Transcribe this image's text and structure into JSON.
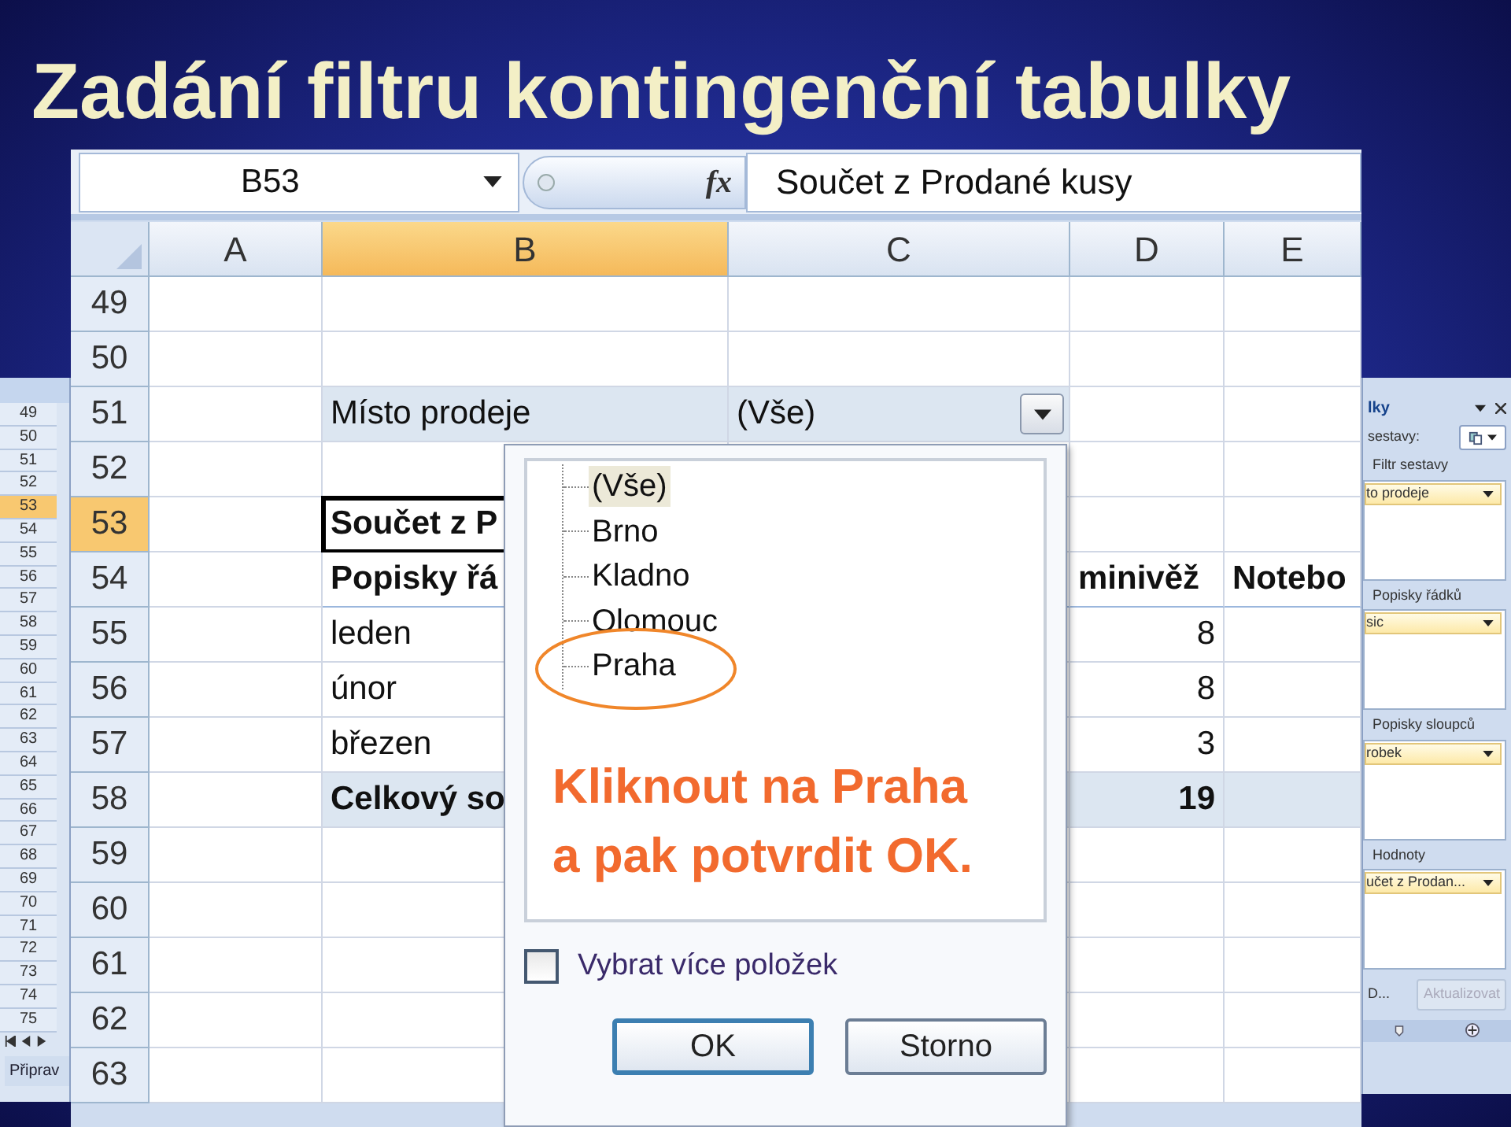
{
  "title": "Zadání filtru kontingenční tabulky",
  "background_sheet": {
    "row_numbers": [
      {
        "label": "49",
        "selected": false
      },
      {
        "label": "50",
        "selected": false
      },
      {
        "label": "51",
        "selected": false
      },
      {
        "label": "52",
        "selected": false
      },
      {
        "label": "53",
        "selected": true
      },
      {
        "label": "54",
        "selected": false
      },
      {
        "label": "55",
        "selected": false
      },
      {
        "label": "56",
        "selected": false
      },
      {
        "label": "57",
        "selected": false
      },
      {
        "label": "58",
        "selected": false
      },
      {
        "label": "59",
        "selected": false
      },
      {
        "label": "60",
        "selected": false
      },
      {
        "label": "61",
        "selected": false
      },
      {
        "label": "62",
        "selected": false
      },
      {
        "label": "63",
        "selected": false
      },
      {
        "label": "64",
        "selected": false
      },
      {
        "label": "65",
        "selected": false
      },
      {
        "label": "66",
        "selected": false
      },
      {
        "label": "67",
        "selected": false
      },
      {
        "label": "68",
        "selected": false
      },
      {
        "label": "69",
        "selected": false
      },
      {
        "label": "70",
        "selected": false
      },
      {
        "label": "71",
        "selected": false
      },
      {
        "label": "72",
        "selected": false
      },
      {
        "label": "73",
        "selected": false
      },
      {
        "label": "74",
        "selected": false
      },
      {
        "label": "75",
        "selected": false
      }
    ],
    "sheet_tab": "Připrav"
  },
  "field_list_panel": {
    "title": "lky",
    "layout_label": "sestavy:",
    "areas": [
      {
        "label": "Filtr sestavy",
        "field": "to prodeje"
      },
      {
        "label": "Popisky řádků",
        "field": "sic"
      },
      {
        "label": "Popisky sloupců",
        "field": "robek"
      },
      {
        "label": "Hodnoty",
        "field": "učet z Prodan..."
      }
    ],
    "defer_label": "D...",
    "update_button": {
      "label": "Aktualizovat",
      "disabled": true
    }
  },
  "formula_bar": {
    "name_box": "B53",
    "function_label": "fx",
    "formula": "Součet z Prodané kusy"
  },
  "columns": [
    {
      "label": "A",
      "selected": false
    },
    {
      "label": "B",
      "selected": true
    },
    {
      "label": "C",
      "selected": false
    },
    {
      "label": "D",
      "selected": false
    },
    {
      "label": "E",
      "selected": false
    }
  ],
  "rows": [
    {
      "number": "49",
      "selected": false,
      "kind": "plain"
    },
    {
      "number": "50",
      "selected": false,
      "kind": "plain"
    },
    {
      "number": "51",
      "selected": false,
      "kind": "filter",
      "b": "Místo prodeje",
      "c": "(Vše)"
    },
    {
      "number": "52",
      "selected": false,
      "kind": "plain"
    },
    {
      "number": "53",
      "selected": true,
      "kind": "active",
      "b": "Součet z P"
    },
    {
      "number": "54",
      "selected": false,
      "kind": "header",
      "b": "Popisky řá",
      "d": "minivěž",
      "e": "Notebo"
    },
    {
      "number": "55",
      "selected": false,
      "kind": "plain",
      "b": "leden",
      "d": "8"
    },
    {
      "number": "56",
      "selected": false,
      "kind": "plain",
      "b": "únor",
      "d": "8"
    },
    {
      "number": "57",
      "selected": false,
      "kind": "plain",
      "b": "březen",
      "d": "3"
    },
    {
      "number": "58",
      "selected": false,
      "kind": "total",
      "b": "Celkový so",
      "d": "19"
    },
    {
      "number": "59",
      "selected": false,
      "kind": "plain"
    },
    {
      "number": "60",
      "selected": false,
      "kind": "plain"
    },
    {
      "number": "61",
      "selected": false,
      "kind": "plain"
    },
    {
      "number": "62",
      "selected": false,
      "kind": "plain"
    },
    {
      "number": "63",
      "selected": false,
      "kind": "plain"
    }
  ],
  "filter_popup": {
    "items": [
      {
        "label": "(Vše)",
        "selected": true
      },
      {
        "label": "Brno",
        "selected": false
      },
      {
        "label": "Kladno",
        "selected": false
      },
      {
        "label": "Olomouc",
        "selected": false
      },
      {
        "label": "Praha",
        "selected": false
      }
    ],
    "annotation": [
      "Kliknout na Praha",
      "a pak potvrdit OK."
    ],
    "multi_select": {
      "label": "Vybrat více položek",
      "checked": false
    },
    "buttons": [
      "OK",
      "Storno"
    ]
  }
}
